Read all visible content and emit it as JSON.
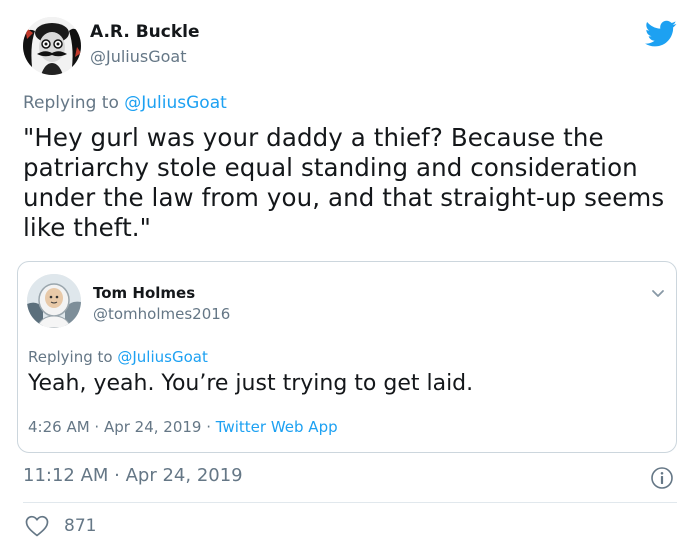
{
  "tweet": {
    "author_name": "A.R. Buckle",
    "author_handle": "@JuliusGoat",
    "reply_prefix": "Replying to",
    "reply_to": "@JuliusGoat",
    "text": "\"Hey gurl was your daddy a thief? Because the patriarchy stole equal standing and consideration under the law from you, and that straight-up seems like theft.\"",
    "timestamp": "11:12 AM · Apr 24, 2019",
    "like_count": "871"
  },
  "quoted_tweet": {
    "author_name": "Tom Holmes",
    "author_handle": "@tomholmes2016",
    "reply_prefix": "Replying to",
    "reply_to": "@JuliusGoat",
    "text": "Yeah, yeah. You’re just trying to get laid.",
    "time_date": "4:26 AM · Apr 24, 2019 ·",
    "source": "Twitter Web App"
  },
  "colors": {
    "accent": "#1da1f2",
    "secondary_text": "#657786",
    "border": "#ccd6dd"
  },
  "icons": {
    "brand": "twitter-bird-icon",
    "info": "info-icon",
    "like": "heart-icon",
    "menu": "chevron-down-icon"
  }
}
